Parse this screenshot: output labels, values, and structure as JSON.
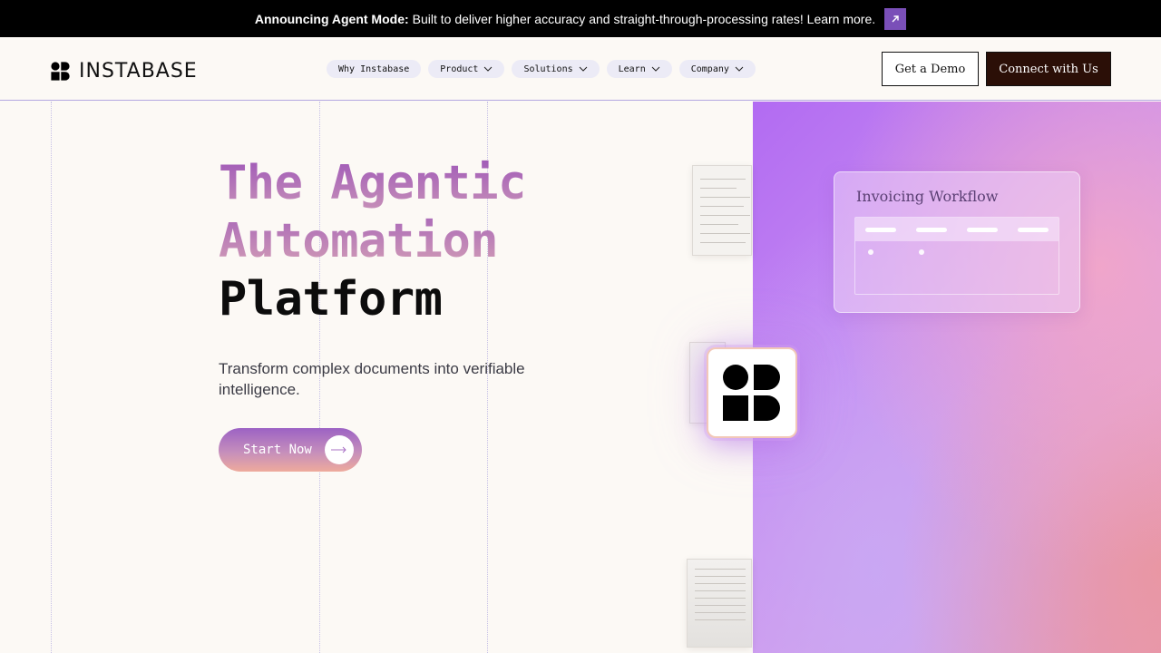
{
  "announcement": {
    "bold": "Announcing Agent Mode:",
    "text": "Built to deliver higher accuracy and straight-through-processing rates! Learn more."
  },
  "brand": {
    "name": "INSTABASE"
  },
  "nav": {
    "items": [
      {
        "label": "Why Instabase",
        "has_dropdown": false
      },
      {
        "label": "Product",
        "has_dropdown": true
      },
      {
        "label": "Solutions",
        "has_dropdown": true
      },
      {
        "label": "Learn",
        "has_dropdown": true
      },
      {
        "label": "Company",
        "has_dropdown": true
      }
    ]
  },
  "header": {
    "demo_label": "Get a Demo",
    "connect_label": "Connect with Us"
  },
  "hero": {
    "line1": "The Agentic",
    "line2": "Automation",
    "line3": "Platform",
    "subtitle": "Transform complex documents into verifiable intelligence.",
    "cta_label": "Start Now"
  },
  "workflow_card": {
    "title": "Invoicing Workflow"
  },
  "colors": {
    "announce_bg": "#000000",
    "arrow_button": "#7a4fb8",
    "connect_bg": "#2b0f07",
    "page_bg": "#fcf9f5",
    "panel_purple": "#b26bf2",
    "panel_pink": "#e49ab8"
  },
  "icons": {
    "announce_arrow": "arrow-up-right-icon",
    "nav_chevron": "chevron-down-icon",
    "cta_arrow": "arrow-right-icon",
    "logo": "instabase-logo-icon"
  }
}
